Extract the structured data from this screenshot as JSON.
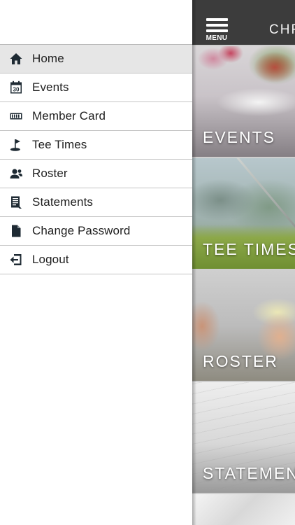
{
  "drawer": {
    "items": [
      {
        "label": "Home",
        "icon": "home-icon"
      },
      {
        "label": "Events",
        "icon": "calendar-icon"
      },
      {
        "label": "Member Card",
        "icon": "card-icon"
      },
      {
        "label": "Tee Times",
        "icon": "golf-flag-icon"
      },
      {
        "label": "Roster",
        "icon": "people-icon"
      },
      {
        "label": "Statements",
        "icon": "statement-icon"
      },
      {
        "label": "Change Password",
        "icon": "document-icon"
      },
      {
        "label": "Logout",
        "icon": "logout-icon"
      }
    ],
    "active_index": 0,
    "calendar_day": "30"
  },
  "topbar": {
    "menu_label": "MENU",
    "title": "CHR"
  },
  "tiles": [
    {
      "label": "EVENTS"
    },
    {
      "label": "TEE TIMES"
    },
    {
      "label": "ROSTER"
    },
    {
      "label": "STATEMENTS"
    }
  ],
  "colors": {
    "topbar": "#3c3c3c",
    "active_item": "#e6e6e6",
    "icon": "#1e2a33"
  }
}
